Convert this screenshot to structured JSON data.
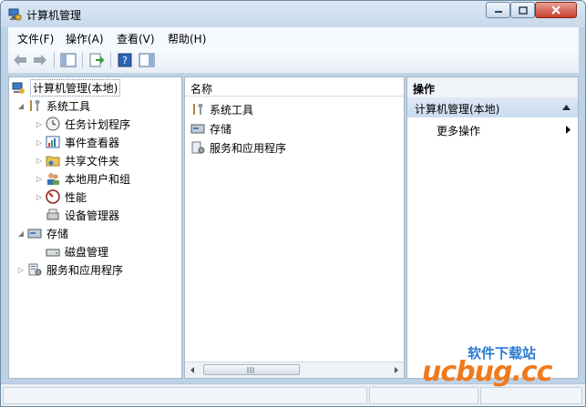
{
  "window": {
    "title": "计算机管理"
  },
  "menu": {
    "file": "文件(F)",
    "action": "操作(A)",
    "view": "查看(V)",
    "help": "帮助(H)"
  },
  "tree": {
    "root": "计算机管理(本地)",
    "system_tools": "系统工具",
    "task_scheduler": "任务计划程序",
    "event_viewer": "事件查看器",
    "shared_folders": "共享文件夹",
    "local_users": "本地用户和组",
    "performance": "性能",
    "device_manager": "设备管理器",
    "storage": "存储",
    "disk_management": "磁盘管理",
    "services_apps": "服务和应用程序"
  },
  "list": {
    "column": "名称",
    "items": [
      "系统工具",
      "存储",
      "服务和应用程序"
    ]
  },
  "actions": {
    "header": "操作",
    "section": "计算机管理(本地)",
    "more": "更多操作"
  },
  "watermark": {
    "brand": "ucbug.cc",
    "tagline": "软件下载站"
  }
}
